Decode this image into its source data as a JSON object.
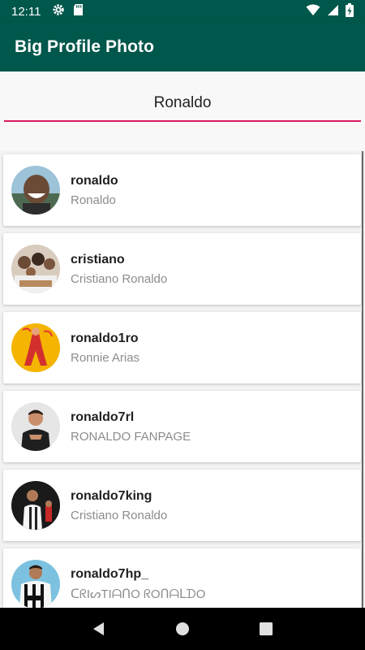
{
  "status_bar": {
    "time": "12:11",
    "icons": [
      "gear-icon",
      "sd-card-icon",
      "wifi-icon",
      "signal-icon",
      "battery-charging-icon"
    ]
  },
  "app_bar": {
    "title": "Big Profile Photo"
  },
  "search": {
    "value": "Ronaldo"
  },
  "colors": {
    "primary": "#00574b",
    "accent": "#d81b60"
  },
  "results": [
    {
      "username": "ronaldo",
      "name": "Ronaldo"
    },
    {
      "username": "cristiano",
      "name": "Cristiano Ronaldo"
    },
    {
      "username": "ronaldo1ro",
      "name": "Ronnie Arias"
    },
    {
      "username": "ronaldo7rl",
      "name": "RONALDO FANPAGE"
    },
    {
      "username": "ronaldo7king",
      "name": "Cristiano Ronaldo"
    },
    {
      "username": "ronaldo7hp_",
      "name": "ᑕᖇIᔕTIᗩᑎO ᖇOᑎᗩᒪᗪO"
    }
  ],
  "nav_bar": {
    "icons": [
      "back-icon",
      "home-icon",
      "recents-icon"
    ]
  }
}
